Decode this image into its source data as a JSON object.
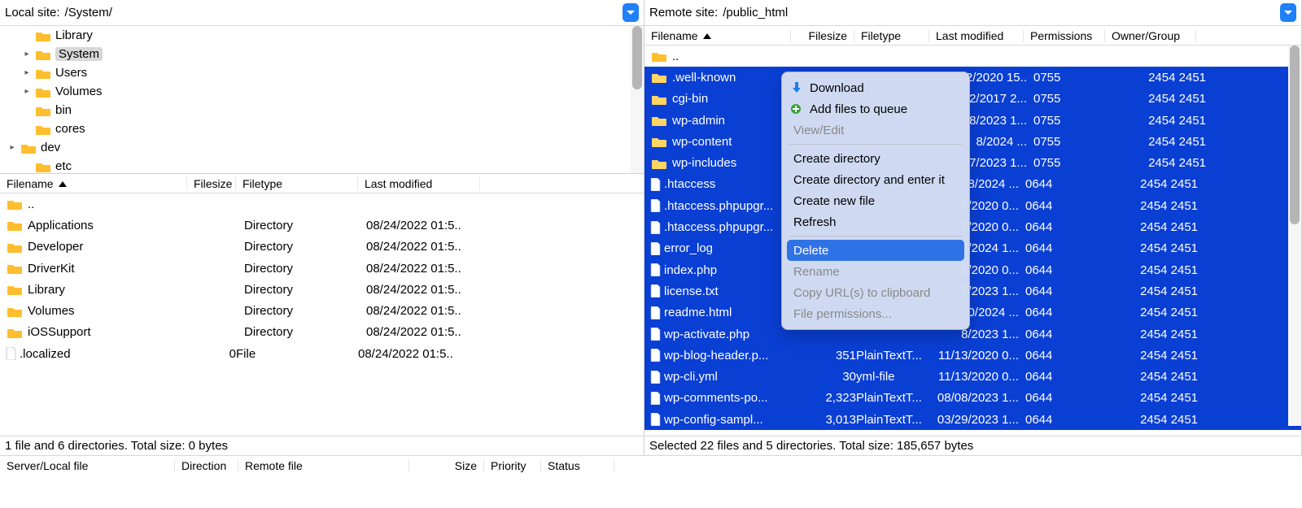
{
  "local": {
    "label": "Local site:",
    "path": "/System/",
    "tree": [
      {
        "indent": 1,
        "tw": "",
        "name": "Library"
      },
      {
        "indent": 1,
        "tw": "▸",
        "name": "System",
        "selected": true
      },
      {
        "indent": 1,
        "tw": "▸",
        "name": "Users"
      },
      {
        "indent": 1,
        "tw": "▸",
        "name": "Volumes"
      },
      {
        "indent": 1,
        "tw": "",
        "name": "bin"
      },
      {
        "indent": 1,
        "tw": "",
        "name": "cores"
      },
      {
        "indent": 0,
        "tw": "▸",
        "name": "dev",
        "extra": true
      },
      {
        "indent": 1,
        "tw": "",
        "name": "etc"
      }
    ],
    "hdr": {
      "c1": "Filename",
      "c2": "Filesize",
      "c3": "Filetype",
      "c4": "Last modified"
    },
    "rows": [
      {
        "icon": "folder",
        "name": "..",
        "size": "",
        "type": "",
        "mod": ""
      },
      {
        "icon": "folder",
        "name": "Applications",
        "size": "",
        "type": "Directory",
        "mod": "08/24/2022 01:5.."
      },
      {
        "icon": "folder",
        "name": "Developer",
        "size": "",
        "type": "Directory",
        "mod": "08/24/2022 01:5.."
      },
      {
        "icon": "folder",
        "name": "DriverKit",
        "size": "",
        "type": "Directory",
        "mod": "08/24/2022 01:5.."
      },
      {
        "icon": "folder",
        "name": "Library",
        "size": "",
        "type": "Directory",
        "mod": "08/24/2022 01:5.."
      },
      {
        "icon": "folder",
        "name": "Volumes",
        "size": "",
        "type": "Directory",
        "mod": "08/24/2022 01:5.."
      },
      {
        "icon": "folder",
        "name": "iOSSupport",
        "size": "",
        "type": "Directory",
        "mod": "08/24/2022 01:5.."
      },
      {
        "icon": "file",
        "name": ".localized",
        "size": "0",
        "type": "File",
        "mod": "08/24/2022 01:5.."
      }
    ],
    "status": "1 file and 6 directories. Total size: 0 bytes"
  },
  "remote": {
    "label": "Remote site:",
    "path": "/public_html",
    "hdr": {
      "c1": "Filename",
      "c2": "Filesize",
      "c3": "Filetype",
      "c4": "Last modified",
      "c5": "Permissions",
      "c6": "Owner/Group"
    },
    "rows": [
      {
        "icon": "folder",
        "name": "..",
        "size": "",
        "type": "",
        "mod": "",
        "perm": "",
        "own": ""
      },
      {
        "icon": "folder",
        "name": ".well-known",
        "size": "",
        "type": "",
        "mod": "2/2020 15..",
        "perm": "0755",
        "own": "2454 2451"
      },
      {
        "icon": "folder",
        "name": "cgi-bin",
        "size": "",
        "type": "",
        "mod": "2/2017 2...",
        "perm": "0755",
        "own": "2454 2451"
      },
      {
        "icon": "folder",
        "name": "wp-admin",
        "size": "",
        "type": "",
        "mod": "8/2023 1...",
        "perm": "0755",
        "own": "2454 2451"
      },
      {
        "icon": "folder",
        "name": "wp-content",
        "size": "",
        "type": "",
        "mod": "8/2024 ...",
        "perm": "0755",
        "own": "2454 2451"
      },
      {
        "icon": "folder",
        "name": "wp-includes",
        "size": "",
        "type": "",
        "mod": "7/2023 1...",
        "perm": "0755",
        "own": "2454 2451"
      },
      {
        "icon": "file",
        "name": ".htaccess",
        "size": "",
        "type": "",
        "mod": "8/2024 ...",
        "perm": "0644",
        "own": "2454 2451"
      },
      {
        "icon": "file",
        "name": ".htaccess.phpupgr...",
        "size": "",
        "type": "",
        "mod": "7/2020 0...",
        "perm": "0644",
        "own": "2454 2451"
      },
      {
        "icon": "file",
        "name": ".htaccess.phpupgr...",
        "size": "",
        "type": "",
        "mod": "7/2020 0...",
        "perm": "0644",
        "own": "2454 2451"
      },
      {
        "icon": "file",
        "name": "error_log",
        "size": "",
        "type": "",
        "mod": "7/2024 1...",
        "perm": "0644",
        "own": "2454 2451"
      },
      {
        "icon": "file",
        "name": "index.php",
        "size": "",
        "type": "",
        "mod": "2/2020 0...",
        "perm": "0644",
        "own": "2454 2451"
      },
      {
        "icon": "file",
        "name": "license.txt",
        "size": "",
        "type": "",
        "mod": "7/2023 1...",
        "perm": "0644",
        "own": "2454 2451"
      },
      {
        "icon": "file",
        "name": "readme.html",
        "size": "",
        "type": "",
        "mod": "0/2024 ...",
        "perm": "0644",
        "own": "2454 2451"
      },
      {
        "icon": "file",
        "name": "wp-activate.php",
        "size": "",
        "type": "",
        "mod": "8/2023 1...",
        "perm": "0644",
        "own": "2454 2451"
      },
      {
        "icon": "file",
        "name": "wp-blog-header.p...",
        "size": "351",
        "type": "PlainTextT...",
        "mod": "11/13/2020 0...",
        "perm": "0644",
        "own": "2454 2451"
      },
      {
        "icon": "file",
        "name": "wp-cli.yml",
        "size": "30",
        "type": "yml-file",
        "mod": "11/13/2020 0...",
        "perm": "0644",
        "own": "2454 2451"
      },
      {
        "icon": "file",
        "name": "wp-comments-po...",
        "size": "2,323",
        "type": "PlainTextT...",
        "mod": "08/08/2023 1...",
        "perm": "0644",
        "own": "2454 2451"
      },
      {
        "icon": "file",
        "name": "wp-config-sampl...",
        "size": "3,013",
        "type": "PlainTextT...",
        "mod": "03/29/2023 1...",
        "perm": "0644",
        "own": "2454 2451"
      }
    ],
    "status": "Selected 22 files and 5 directories. Total size: 185,657 bytes"
  },
  "ctx": {
    "download": "Download",
    "add_queue": "Add files to queue",
    "view_edit": "View/Edit",
    "create_dir": "Create directory",
    "create_enter": "Create directory and enter it",
    "create_file": "Create new file",
    "refresh": "Refresh",
    "delete": "Delete",
    "rename": "Rename",
    "copy_url": "Copy URL(s) to clipboard",
    "file_perm": "File permissions..."
  },
  "bottom_hdr": {
    "c1": "Server/Local file",
    "c2": "Direction",
    "c3": "Remote file",
    "c4": "Size",
    "c5": "Priority",
    "c6": "Status"
  }
}
